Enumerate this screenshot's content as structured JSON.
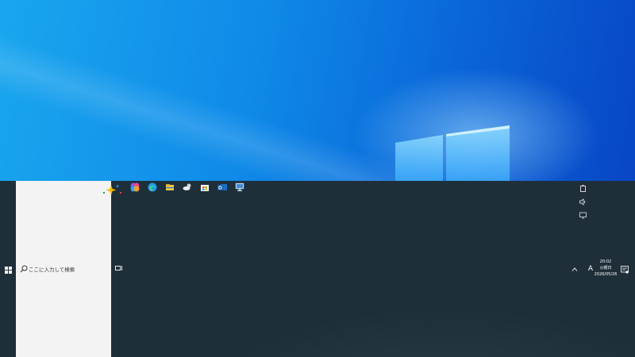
{
  "taskbar": {
    "search_placeholder": "ここに入力して検索",
    "pinned_apps": [
      "copilot-icon",
      "edge-icon",
      "file-explorer-icon",
      "weather-icon",
      "store-icon",
      "outlook-icon",
      "network-icon"
    ],
    "clock": {
      "time": "20:02",
      "day": "火曜日",
      "date": "2026/05/26"
    },
    "ime_label": "A"
  },
  "colors": {
    "taskbar_bg": "#243540",
    "search_bg": "#f3f3f3",
    "wallpaper_accent": "#0f8ae8"
  }
}
